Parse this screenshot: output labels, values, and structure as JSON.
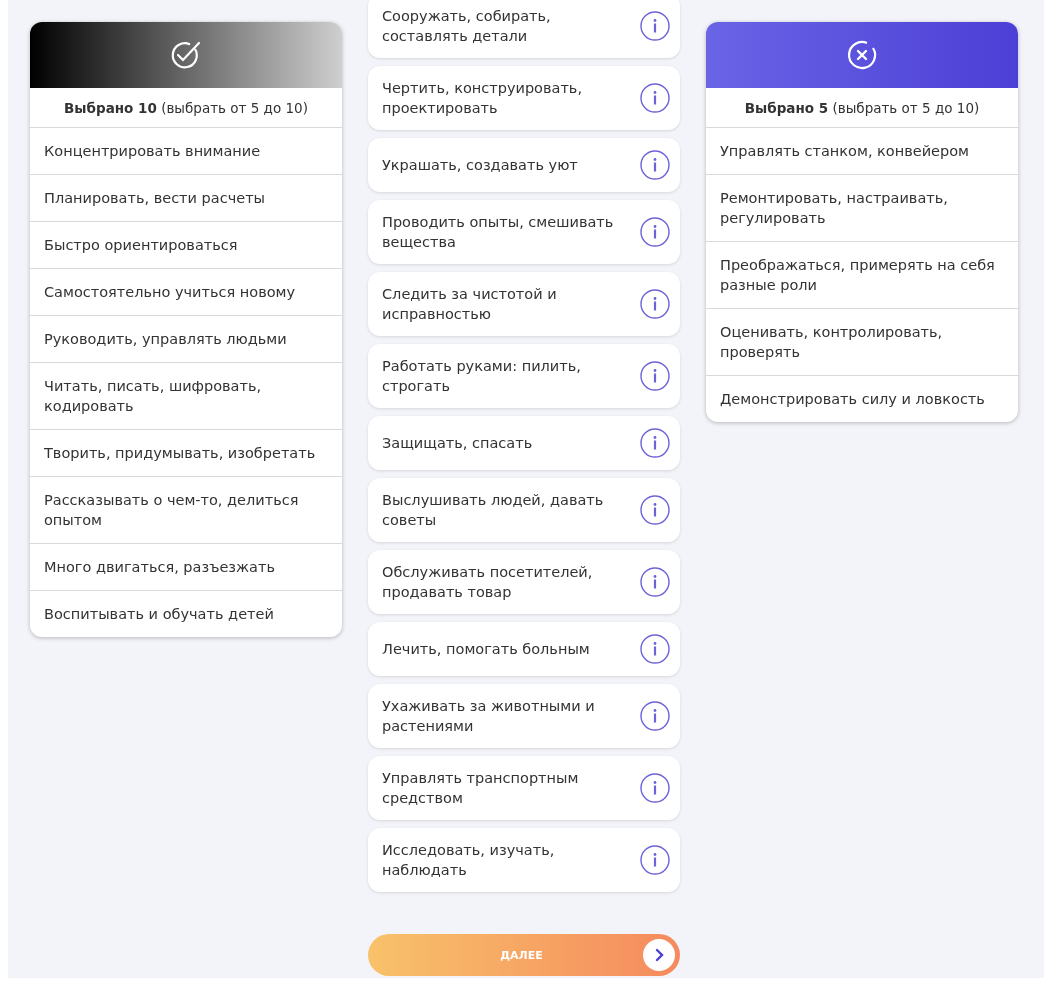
{
  "panels": [
    {
      "kind": "selected",
      "count_label": "**Выбрано 10**  (выбрать от 5 до 10)",
      "items": [
        "Концентрировать внимание",
        "Планировать, вести расчеты",
        "Быстро ориентироваться",
        "Самостоятельно учиться новому",
        "Руководить, управлять людьми",
        "Читать, писать, шифровать, кодировать",
        "Творить, придумывать, изобретать",
        "Рассказывать о чем-то, делиться опытом",
        "Много двигаться, разъезжать",
        "Воспитывать и обучать детей"
      ]
    },
    {
      "kind": "rejected",
      "count_label": "**Выбрано 5**  (выбрать от 5 до 10)",
      "items": [
        "Управлять станком, конвейером",
        "Ремонтировать, настраивать, регулировать",
        "Преображаться, примерять на себя разные роли",
        "Оценивать, контролировать, проверять",
        "Демонстрировать силу и ловкость"
      ]
    }
  ],
  "options": [
    "Сооружать, собирать, составлять детали",
    "Чертить, конструировать, проектировать",
    "Украшать, создавать уют",
    "Проводить опыты, смешивать вещества",
    "Следить за чистотой и исправностью",
    "Работать руками: пилить, строгать",
    "Защищать, спасать",
    "Выслушивать людей, давать советы",
    "Обслуживать посетителей, продавать товар",
    "Лечить, помогать больным",
    "Ухаживать за животными и растениями",
    "Управлять транспортным средством",
    "Исследовать, изучать, наблюдать"
  ],
  "next_button": {
    "label": "ДАЛЕЕ"
  }
}
